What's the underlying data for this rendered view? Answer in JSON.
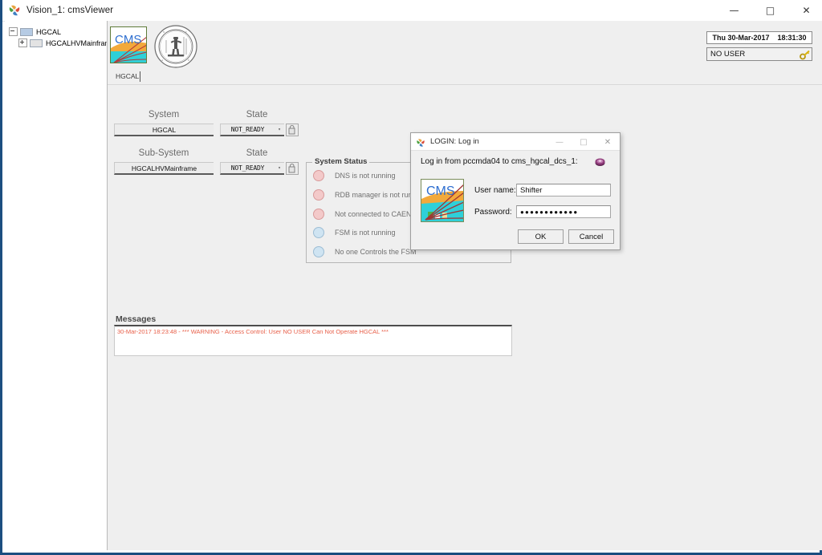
{
  "window": {
    "title": "Vision_1: cmsViewer",
    "icon": "pinwheel-icon",
    "controls": {
      "minimize": "—",
      "maximize": "□",
      "close": "✕"
    }
  },
  "tree": {
    "root": {
      "label": "HGCAL",
      "toggle": "minus",
      "selected": true
    },
    "child": {
      "label": "HGCALHVMainframe",
      "toggle": "plus",
      "selected": false
    }
  },
  "header": {
    "cms_logo": "cms-logo",
    "seal_logo": "institute-seal",
    "tab": {
      "label": "HGCAL"
    },
    "clock": {
      "day": "Thu  30-Mar-2017",
      "time": "18:31:30"
    },
    "user": {
      "value": "NO USER",
      "icon": "key-icon"
    }
  },
  "panel": {
    "system_label": "System",
    "state_label_1": "State",
    "subsystem_label": "Sub-System",
    "state_label_2": "State",
    "system_value": "HGCAL",
    "subsystem_value": "HGCALHVMainframe",
    "state_value_1": "NOT_READY",
    "state_value_2": "NOT_READY",
    "combo_carat": "▾",
    "lock_icon": "lock-icon"
  },
  "system_status": {
    "title": "System Status",
    "items": [
      {
        "text": "DNS is not running",
        "led": "red"
      },
      {
        "text": "RDB manager is not running",
        "led": "red"
      },
      {
        "text": "Not connected to CAEN",
        "led": "red"
      },
      {
        "text": "FSM is not running",
        "led": "blue"
      },
      {
        "text": "No one Controls the FSM",
        "led": "blue"
      }
    ]
  },
  "messages": {
    "title": "Messages",
    "lines": [
      "30-Mar-2017 18:23:48 - *** WARNING - Access Control: User NO USER Can Not Operate HGCAL ***"
    ]
  },
  "login_dialog": {
    "title": "LOGIN: Log in",
    "icon": "pinwheel-icon",
    "controls": {
      "minimize": "—",
      "maximize": "□",
      "close": "✕"
    },
    "prompt": "Log in from pccmda04 to cms_hgcal_dcs_1:",
    "badge_icon": "badge-icon",
    "logo": "cms-logo",
    "username_label": "User name:",
    "password_label": "Password:",
    "username_value": "Shifter",
    "password_value": "●●●●●●●●●●●●",
    "ok_label": "OK",
    "cancel_label": "Cancel"
  },
  "colors": {
    "window_border": "#1c4e80",
    "main_bg": "#efefef",
    "warning_text": "#e8604a",
    "led_red": "#f3c9c9",
    "led_blue": "#cfe4f2"
  }
}
